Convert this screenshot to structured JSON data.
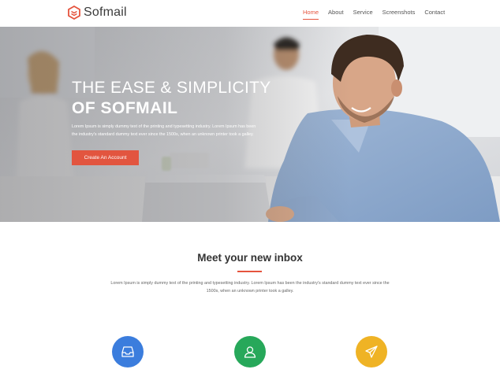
{
  "header": {
    "logo_text": "Sofmail",
    "nav": [
      {
        "label": "Home",
        "active": true
      },
      {
        "label": "About",
        "active": false
      },
      {
        "label": "Service",
        "active": false
      },
      {
        "label": "Screenshots",
        "active": false
      },
      {
        "label": "Contact",
        "active": false
      }
    ]
  },
  "hero": {
    "title_line1": "THE EASE & SIMPLICITY",
    "title_line2": "OF SOFMAIL",
    "text_line1": "Lorem Ipsum is simply dummy text of the printing and typesetting industry. Lorem Ipsum has been",
    "text_line2": "the industry's standard dummy text ever since the 1500s, when an unknown printer took a galley.",
    "cta_label": "Create An Account"
  },
  "intro": {
    "title": "Meet your new inbox",
    "text_line1": "Lorem Ipsum is simply dummy text of the printing and typesetting industry. Lorem Ipsum has been the industry's standard dummy text ever since the",
    "text_line2": "1500s, when an unknown printer took a galley."
  },
  "features": [
    {
      "icon": "inbox-icon",
      "color": "#3b7ddd"
    },
    {
      "icon": "user-icon",
      "color": "#27a85a"
    },
    {
      "icon": "paper-plane-icon",
      "color": "#efb325"
    }
  ],
  "colors": {
    "accent": "#e5533d",
    "button": "#e2553f"
  }
}
